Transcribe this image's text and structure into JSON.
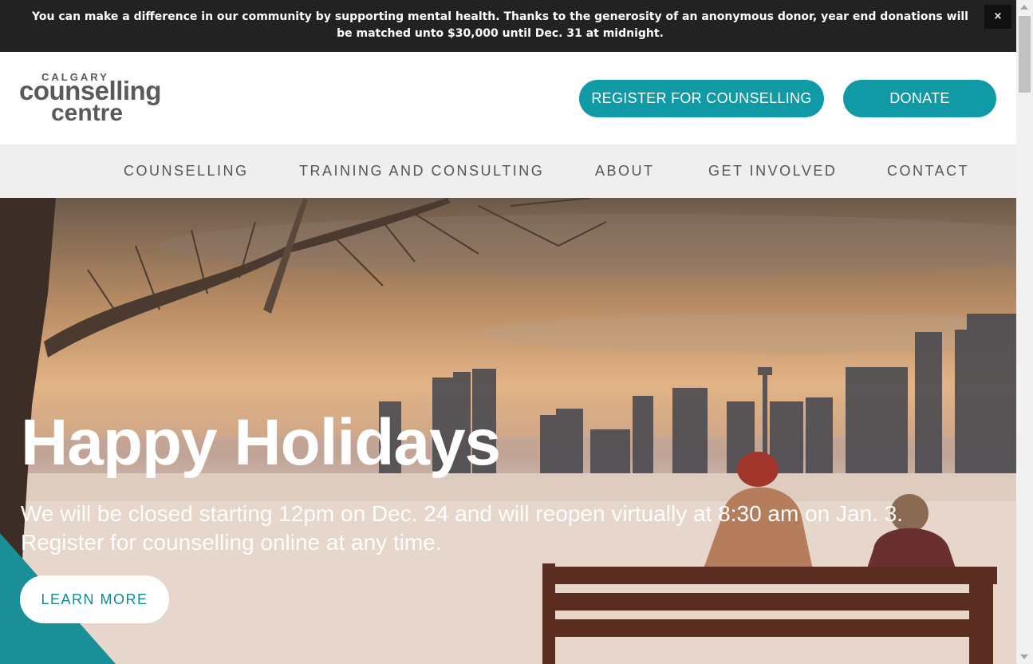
{
  "announcement": {
    "text": "You can make a difference in our community by supporting mental health. Thanks to the generosity of an anonymous donor, year end donations will be matched unto $30,000 until Dec. 31 at midnight.",
    "close_label": "×"
  },
  "logo": {
    "top": "CALGARY",
    "line1": "counselling",
    "line2": "centre"
  },
  "header": {
    "register_label": "REGISTER FOR COUNSELLING",
    "donate_label": "DONATE"
  },
  "nav": {
    "items": [
      {
        "label": "COUNSELLING"
      },
      {
        "label": "TRAINING AND CONSULTING"
      },
      {
        "label": "ABOUT"
      },
      {
        "label": "GET INVOLVED"
      },
      {
        "label": "CONTACT"
      }
    ]
  },
  "hero": {
    "title": "Happy Holidays",
    "text": "We will be closed starting 12pm on Dec. 24 and will reopen virtually at 8:30 am on Jan. 3. Register for counselling online at any time.",
    "button_label": "LEARN MORE"
  },
  "colors": {
    "brand": "#0f9aa6",
    "announcement_bg": "#222222",
    "nav_bg": "#efefef"
  }
}
